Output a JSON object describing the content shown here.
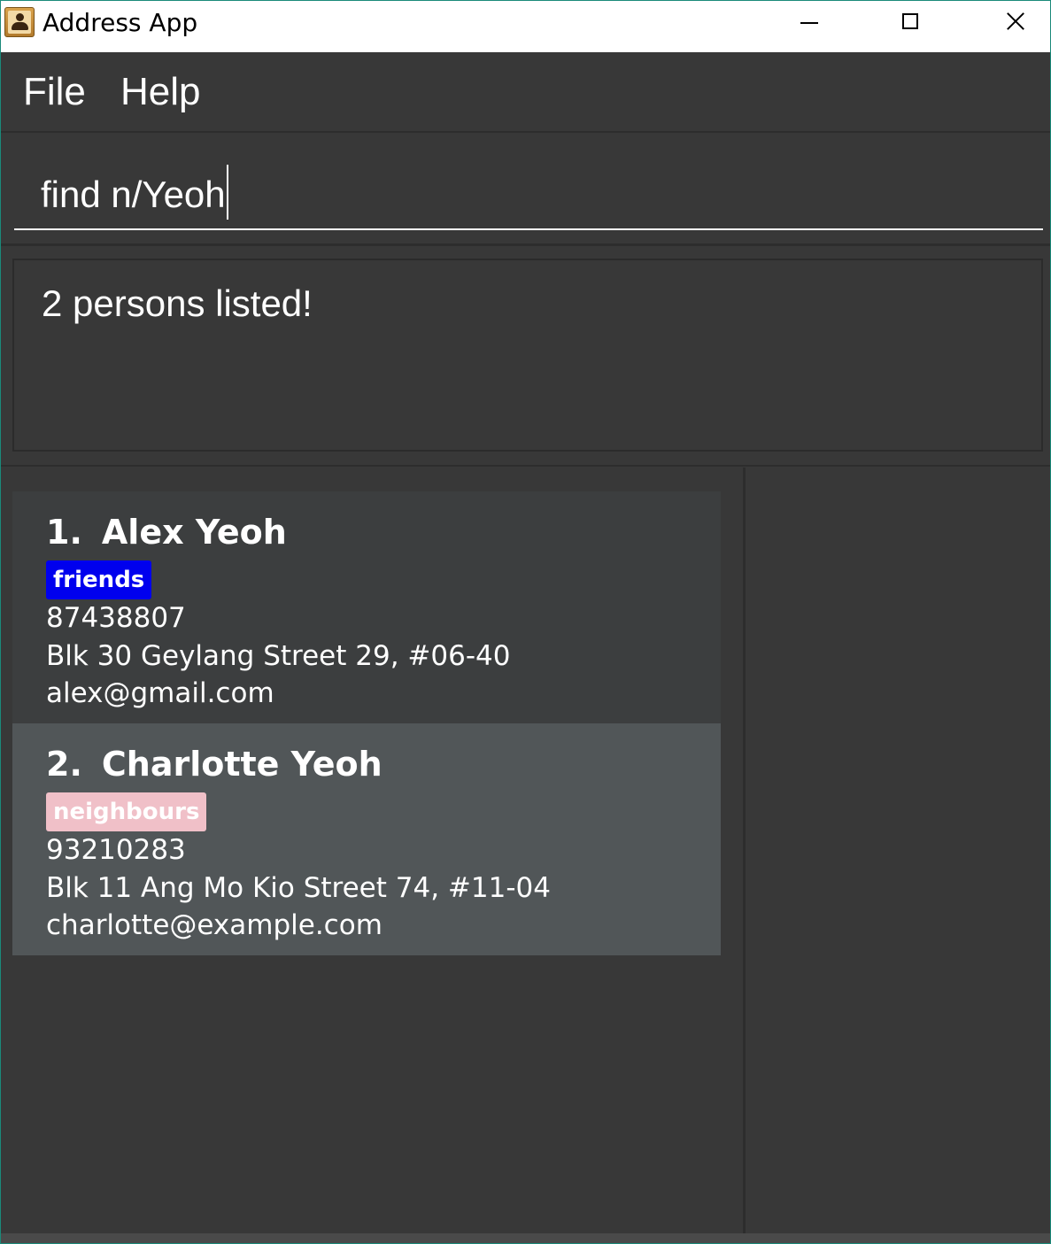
{
  "window": {
    "title": "Address App",
    "icon": "address-book-icon"
  },
  "menu": {
    "items": [
      {
        "label": "File"
      },
      {
        "label": "Help"
      }
    ]
  },
  "command": {
    "value": "find n/Yeoh"
  },
  "result": {
    "message": "2 persons listed!"
  },
  "persons": [
    {
      "index": "1.",
      "name": "Alex Yeoh",
      "tag": "friends",
      "tag_color": "#0000ee",
      "tag_text_color": "#ffffff",
      "phone": "87438807",
      "address": "Blk 30 Geylang Street 29, #06-40",
      "email": "alex@gmail.com"
    },
    {
      "index": "2.",
      "name": "Charlotte Yeoh",
      "tag": "neighbours",
      "tag_color": "#f0c0c8",
      "tag_text_color": "#ffffff",
      "phone": "93210283",
      "address": "Blk 11 Ang Mo Kio Street 74, #11-04",
      "email": "charlotte@example.com"
    }
  ],
  "colors": {
    "background": "#383838",
    "card_default": "#3c3e3f",
    "card_selected": "#515658",
    "window_border": "#1a8a7a"
  }
}
